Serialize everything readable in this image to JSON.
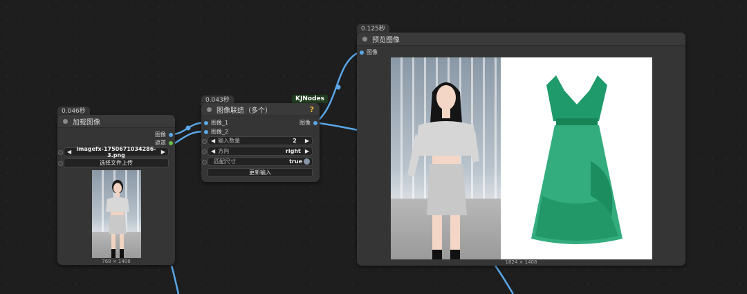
{
  "load_node": {
    "time": "0.046秒",
    "title": "加载图像",
    "outputs": {
      "image": "图像",
      "mask": "遮罩"
    },
    "filename": "imagefx-1750671034286-3.png",
    "upload_button": "选择文件上传",
    "dimensions": "768 × 1408"
  },
  "concat_node": {
    "time": "0.043秒",
    "tag": "KJNodes",
    "title": "图像联结（多个）",
    "help_icon": "?",
    "inputs": {
      "image_1": "图像_1",
      "image_2": "图像_2"
    },
    "output": "图像",
    "widgets": {
      "input_count_label": "输入数量",
      "input_count_value": "2",
      "direction_label": "方向",
      "direction_value": "right",
      "match_size_label": "匹配尺寸",
      "match_size_value": "true"
    },
    "update_button": "更新输入"
  },
  "preview_node": {
    "time": "0.125秒",
    "title": "预览图像",
    "input": "图像",
    "dimensions": "1824 × 1408"
  },
  "colors": {
    "wire": "#5aa7e8",
    "image_slot": "#5aa7e8",
    "mask_slot": "#6abf4b",
    "dress": "#1f9a6b"
  }
}
